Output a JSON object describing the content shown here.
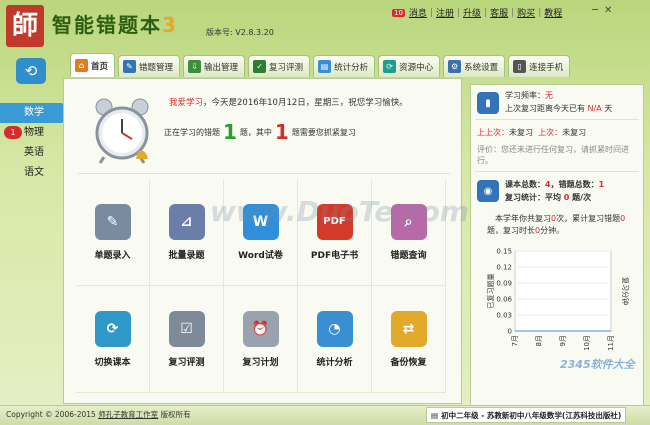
{
  "app": {
    "logo_char": "師",
    "title": "智能错题本",
    "title_num": "3",
    "version": "版本号: V2.8.3.20"
  },
  "topmenu": {
    "msg_badge": "10",
    "items": [
      "消息",
      "注册",
      "升级",
      "客服",
      "购买",
      "教程"
    ],
    "sep": "|"
  },
  "window": {
    "minimize": "─",
    "close": "✕"
  },
  "tabs": [
    {
      "label": "首页",
      "icon": "home-icon",
      "color": "#e07b22",
      "glyph": "⌂"
    },
    {
      "label": "错题管理",
      "icon": "error-manage-icon",
      "color": "#3473b8",
      "glyph": "✎"
    },
    {
      "label": "输出管理",
      "icon": "output-icon",
      "color": "#3b8f3b",
      "glyph": "⇩"
    },
    {
      "label": "复习评测",
      "icon": "review-icon",
      "color": "#2e7d32",
      "glyph": "✓"
    },
    {
      "label": "统计分析",
      "icon": "stats-icon",
      "color": "#3a8fd0",
      "glyph": "▤"
    },
    {
      "label": "资源中心",
      "icon": "resource-icon",
      "color": "#1e9e8e",
      "glyph": "⟳"
    },
    {
      "label": "系统设置",
      "icon": "settings-icon",
      "color": "#3a6fb0",
      "glyph": "⚙"
    },
    {
      "label": "连接手机",
      "icon": "phone-icon",
      "color": "#555555",
      "glyph": "▯"
    }
  ],
  "sidebar": {
    "icon_glyph": "⟲",
    "subjects": [
      {
        "label": "数学",
        "badge": ""
      },
      {
        "label": "物理",
        "badge": "1"
      },
      {
        "label": "英语",
        "badge": ""
      },
      {
        "label": "语文",
        "badge": ""
      }
    ]
  },
  "greeting": {
    "red": "我爱学习",
    "text": "，今天是2016年10月12日，星期三，祝您学习愉快。"
  },
  "progress": {
    "prefix": "正在学习的错题",
    "count": "1",
    "mid": "题，其中",
    "urgent": "1",
    "suffix": "题需要您抓紧复习"
  },
  "functions": [
    {
      "label": "单题录入",
      "glyph": "✎",
      "color": "#7a8aa0"
    },
    {
      "label": "批量录题",
      "glyph": "⊿",
      "color": "#6a7ea8"
    },
    {
      "label": "Word试卷",
      "glyph": "W",
      "color": "#2f8fdb"
    },
    {
      "label": "PDF电子书",
      "glyph": "PDF",
      "color": "#d43a2a"
    },
    {
      "label": "错题查询",
      "glyph": "⌕",
      "color": "#b86aa8"
    },
    {
      "label": "切换课本",
      "glyph": "⟳",
      "color": "#2e98c8"
    },
    {
      "label": "复习评测",
      "glyph": "☑",
      "color": "#7f8a99"
    },
    {
      "label": "复习计划",
      "glyph": "⏰",
      "color": "#9aa3ad"
    },
    {
      "label": "统计分析",
      "glyph": "◔",
      "color": "#3a8fd0"
    },
    {
      "label": "备份恢复",
      "glyph": "⇄",
      "color": "#e2a92a"
    }
  ],
  "right": {
    "freq_label": "学习频率：",
    "freq_value": "无",
    "last_review_pre": "上次复习距离今天已有",
    "last_review_val": "N/A",
    "last_review_suf": "天",
    "last_label1": "上上次：",
    "last_val1": "未复习",
    "last_label2": "上次：",
    "last_val2": "未复习",
    "comment": "评价：您还未进行任何复习，请抓紧时间进行。",
    "books_label": "课本总数：",
    "books_val": "4",
    "errs_label": "，错题总数：",
    "errs_val": "1",
    "review_label": "复习统计：平均",
    "review_val": "0",
    "review_unit": "题/次",
    "year_pre": "本学年你共复习",
    "year_count": "0",
    "year_mid": "次，累计复习错题",
    "year_items": "0",
    "year_time_pre": "题，复习时长",
    "year_time": "0",
    "year_time_suf": "分钟。"
  },
  "chart_data": {
    "type": "line",
    "x": [
      "7月",
      "8月",
      "9月",
      "10月",
      "11月"
    ],
    "y_ticks": [
      "0.15",
      "0.12",
      "0.09",
      "0.06",
      "0.03",
      "0"
    ],
    "ylim": [
      0,
      0.15
    ],
    "ylabel_left": "已复习题量",
    "ylabel_right": "复习分钟",
    "series": [
      {
        "values": [
          0,
          0,
          0,
          0,
          0
        ]
      }
    ]
  },
  "status": {
    "copyright": "Copyright © 2006-2015",
    "company": "师孔子教育工作室",
    "rights": "版权所有",
    "book": "初中二年级 - 苏教新初中八年级数学(江苏科技出版社)"
  }
}
